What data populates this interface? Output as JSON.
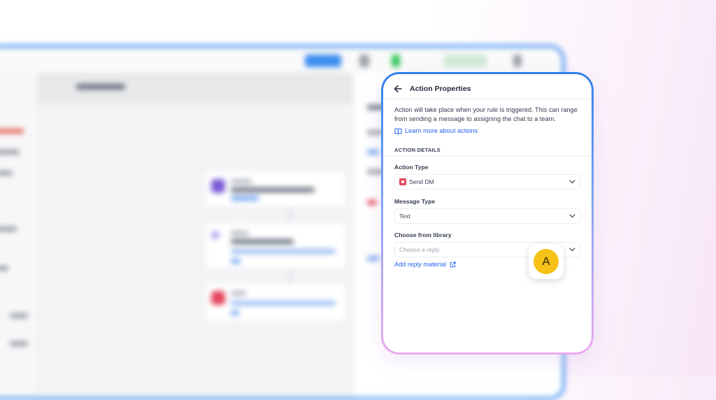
{
  "panel": {
    "title": "Action Properties",
    "description": "Action will take place when your rule is triggered. This can range from sending a message to assigning the chat to a team.",
    "learn_more_label": "Learn more about actions",
    "section_title": "ACTION DETAILS",
    "action_type": {
      "label": "Action Type",
      "value": "Send DM"
    },
    "message_type": {
      "label": "Message Type",
      "value": "Text"
    },
    "library": {
      "label": "Choose from library",
      "placeholder": "Choose a reply"
    },
    "add_reply_label": "Add reply material"
  },
  "avatar": {
    "initial": "A",
    "color": "#f7c218"
  },
  "colors": {
    "accent_blue": "#2563eb",
    "frame_gradient_top": "#2f82ee",
    "frame_gradient_bottom": "#eeaaf0",
    "send_dm_icon": "#e5475f"
  }
}
